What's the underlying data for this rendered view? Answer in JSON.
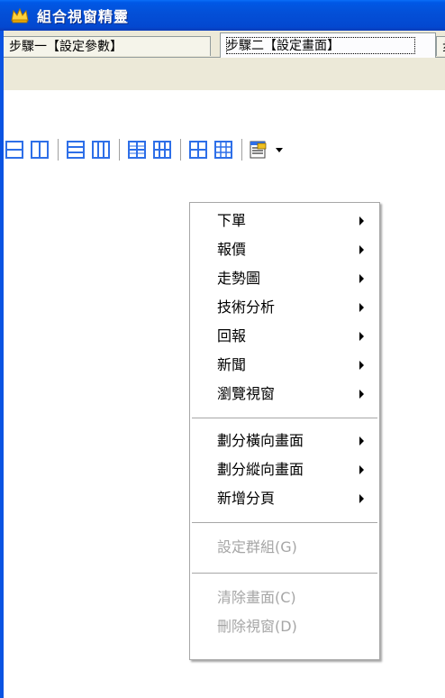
{
  "window": {
    "title": "組合視窗精靈"
  },
  "tabs": [
    {
      "label": "步驟一【設定參數】",
      "selected": false
    },
    {
      "label": "步驟二【設定畫面】",
      "selected": true
    },
    {
      "label": "步",
      "selected": false
    }
  ],
  "toolbar": {
    "buttons": [
      {
        "name": "split-horizontal-2-icon"
      },
      {
        "name": "split-vertical-2-icon"
      },
      {
        "name": "split-horizontal-3-icon"
      },
      {
        "name": "split-vertical-3-icon"
      },
      {
        "name": "grid-2x2-icon"
      },
      {
        "name": "grid-2x3-icon"
      },
      {
        "name": "grid-alt-2x2-icon"
      },
      {
        "name": "grid-3x3-icon"
      },
      {
        "name": "window-menu-icon"
      }
    ]
  },
  "context_menu": {
    "items": [
      {
        "label": "下單",
        "submenu": true,
        "enabled": true
      },
      {
        "label": "報價",
        "submenu": true,
        "enabled": true
      },
      {
        "label": "走勢圖",
        "submenu": true,
        "enabled": true
      },
      {
        "label": "技術分析",
        "submenu": true,
        "enabled": true
      },
      {
        "label": "回報",
        "submenu": true,
        "enabled": true
      },
      {
        "label": "新聞",
        "submenu": true,
        "enabled": true
      },
      {
        "label": "瀏覽視窗",
        "submenu": true,
        "enabled": true
      },
      {
        "label": "劃分橫向畫面",
        "submenu": true,
        "enabled": true
      },
      {
        "label": "劃分縱向畫面",
        "submenu": true,
        "enabled": true
      },
      {
        "label": "新增分頁",
        "submenu": true,
        "enabled": true
      },
      {
        "label": "設定群組(G)",
        "submenu": false,
        "enabled": false
      },
      {
        "label": "清除畫面(C)",
        "submenu": false,
        "enabled": false
      },
      {
        "label": "刪除視窗(D)",
        "submenu": false,
        "enabled": false
      }
    ]
  },
  "colors": {
    "titlebar": "#0348d0",
    "tab_background": "#ece9d8",
    "toolbar_icon": "#2e6fe8",
    "disabled_text": "#a6a6a6"
  }
}
